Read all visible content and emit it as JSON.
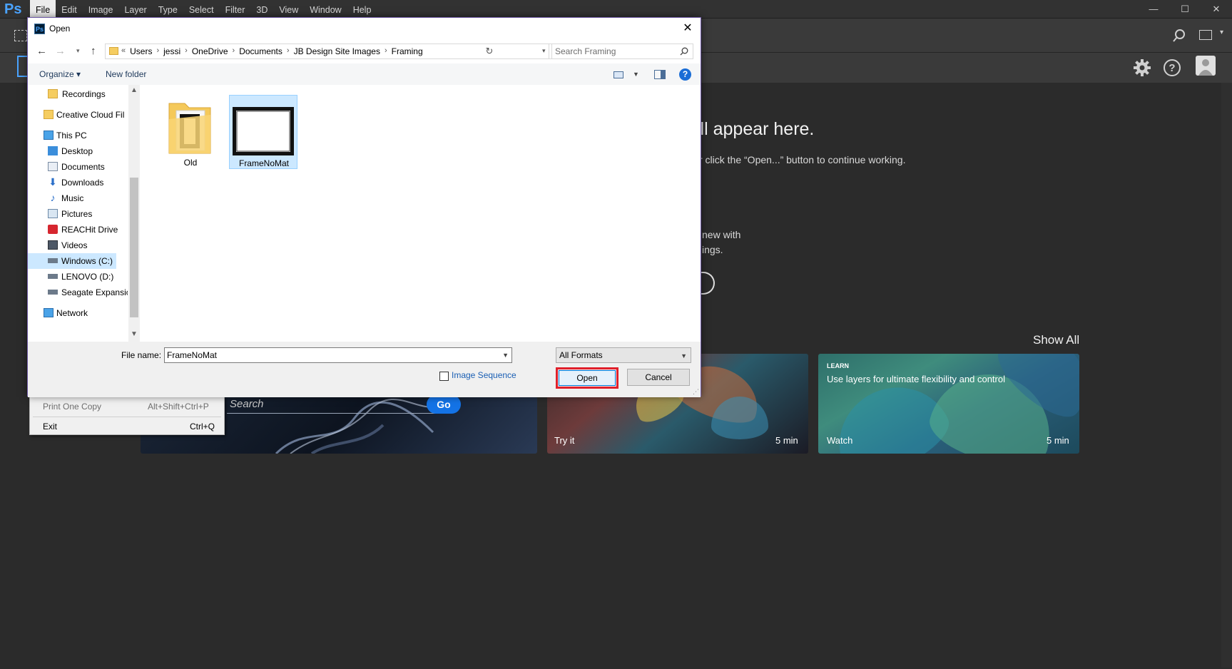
{
  "app": {
    "logo_text": "Ps",
    "menu": [
      "File",
      "Edit",
      "Image",
      "Layer",
      "Type",
      "Select",
      "Filter",
      "3D",
      "View",
      "Window",
      "Help"
    ],
    "window_controls": [
      "—",
      "☐",
      "✕"
    ]
  },
  "home": {
    "recent_heading": "ill appear here.",
    "recent_sub": "r click the “Open...” button to continue working.",
    "new_with_line1": "new with",
    "new_with_line2": "ings.",
    "show_all": "Show All",
    "search_placeholder": "Search",
    "go_label": "Go",
    "cards": {
      "tryit": {
        "action": "Try it",
        "duration": "5 min"
      },
      "learn": {
        "tag": "LEARN",
        "title": "Use layers for ultimate flexibility and control",
        "action": "Watch",
        "duration": "5 min"
      }
    }
  },
  "file_menu": {
    "items": [
      {
        "label": "Print One Copy",
        "shortcut": "Alt+Shift+Ctrl+P",
        "disabled": true
      },
      {
        "label": "Exit",
        "shortcut": "Ctrl+Q",
        "disabled": false
      }
    ]
  },
  "dialog": {
    "title": "Open",
    "icon_text": "Ps",
    "close_glyph": "✕",
    "breadcrumb": [
      "«",
      "Users",
      "jessi",
      "OneDrive",
      "Documents",
      "JB Design Site Images",
      "Framing"
    ],
    "search_placeholder": "Search Framing",
    "toolbar": {
      "organize": "Organize ▾",
      "new_folder": "New folder",
      "help": "?"
    },
    "nav_items": [
      {
        "label": "Recordings",
        "icon": "folder-icon"
      },
      {
        "label": "Creative Cloud Fil",
        "icon": "creative-cloud-icon"
      },
      {
        "label": "This PC",
        "icon": "pc-icon"
      },
      {
        "label": "Desktop",
        "icon": "desktop-icon"
      },
      {
        "label": "Documents",
        "icon": "documents-icon"
      },
      {
        "label": "Downloads",
        "icon": "downloads-icon"
      },
      {
        "label": "Music",
        "icon": "music-icon"
      },
      {
        "label": "Pictures",
        "icon": "pictures-icon"
      },
      {
        "label": "REACHit Drive",
        "icon": "reachit-drive-icon"
      },
      {
        "label": "Videos",
        "icon": "videos-icon"
      },
      {
        "label": "Windows (C:)",
        "icon": "drive-c-icon",
        "selected": true
      },
      {
        "label": "LENOVO (D:)",
        "icon": "drive-d-icon"
      },
      {
        "label": "Seagate Expansic",
        "icon": "drive-seagate-icon"
      },
      {
        "label": "Network",
        "icon": "network-icon"
      }
    ],
    "files": [
      {
        "name": "Old",
        "type": "folder"
      },
      {
        "name": "FrameNoMat",
        "type": "image",
        "selected": true
      }
    ],
    "file_name_label": "File name:",
    "file_name_value": "FrameNoMat",
    "format_value": "All Formats",
    "image_sequence_label": "Image Sequence",
    "open_label": "Open",
    "cancel_label": "Cancel"
  },
  "colors": {
    "ps_blue": "#4aa3ff",
    "highlight_red": "#e0202b",
    "selection_blue": "#cce8ff",
    "go_blue": "#1473e6"
  }
}
